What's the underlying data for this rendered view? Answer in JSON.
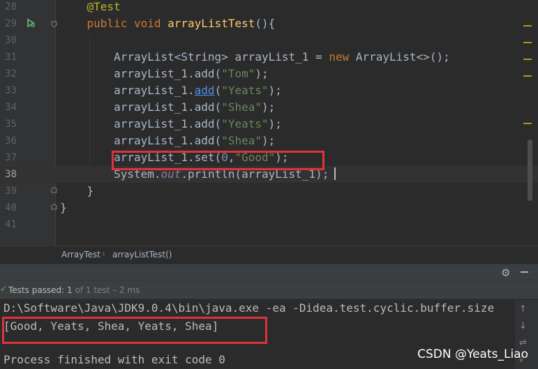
{
  "editor": {
    "lines": [
      {
        "num": "28",
        "tokens": [
          {
            "t": "    "
          },
          {
            "t": "@Test",
            "c": "t-ann"
          }
        ]
      },
      {
        "num": "29",
        "tokens": [
          {
            "t": "    "
          },
          {
            "t": "public",
            "c": "t-kw"
          },
          {
            "t": " "
          },
          {
            "t": "void",
            "c": "t-kw"
          },
          {
            "t": " "
          },
          {
            "t": "arrayListTest",
            "c": "t-fn"
          },
          {
            "t": "(){"
          }
        ]
      },
      {
        "num": "30",
        "tokens": []
      },
      {
        "num": "31",
        "tokens": [
          {
            "t": "        ArrayList<String> arrayList_1 = "
          },
          {
            "t": "new",
            "c": "t-kw"
          },
          {
            "t": " ArrayList<>();"
          }
        ]
      },
      {
        "num": "32",
        "tokens": [
          {
            "t": "        arrayList_1.add("
          },
          {
            "t": "\"Tom\"",
            "c": "t-str"
          },
          {
            "t": ");"
          }
        ]
      },
      {
        "num": "33",
        "tokens": [
          {
            "t": "        arrayList_1."
          },
          {
            "t": "add",
            "c": "t-link"
          },
          {
            "t": "("
          },
          {
            "t": "\"Yeats\"",
            "c": "t-str"
          },
          {
            "t": ");"
          }
        ]
      },
      {
        "num": "34",
        "tokens": [
          {
            "t": "        arrayList_1.add("
          },
          {
            "t": "\"Shea\"",
            "c": "t-str"
          },
          {
            "t": ");"
          }
        ]
      },
      {
        "num": "35",
        "tokens": [
          {
            "t": "        arrayList_1.add("
          },
          {
            "t": "\"Yeats\"",
            "c": "t-str"
          },
          {
            "t": ");"
          }
        ]
      },
      {
        "num": "36",
        "tokens": [
          {
            "t": "        arrayList_1.add("
          },
          {
            "t": "\"Shea\"",
            "c": "t-str"
          },
          {
            "t": ");"
          }
        ]
      },
      {
        "num": "37",
        "tokens": [
          {
            "t": "        arrayList_1.set("
          },
          {
            "t": "0",
            "c": "t-num"
          },
          {
            "t": ","
          },
          {
            "t": "\"Good\"",
            "c": "t-str"
          },
          {
            "t": ");"
          }
        ]
      },
      {
        "num": "38",
        "current": true,
        "tokens": [
          {
            "t": "        System."
          },
          {
            "t": "out",
            "c": "t-static"
          },
          {
            "t": ".println(arrayList_1);"
          }
        ]
      },
      {
        "num": "39",
        "tokens": [
          {
            "t": "    }"
          }
        ]
      },
      {
        "num": "40",
        "tokens": [
          {
            "t": "}"
          }
        ]
      },
      {
        "num": "41",
        "tokens": []
      }
    ]
  },
  "breadcrumb": {
    "class_name": "ArrayTest",
    "method_name": "arrayListTest()"
  },
  "run_panel": {
    "status_main": "Tests passed: ",
    "status_count": "1",
    "status_rest": " of 1 test – 2 ms",
    "console_lines": [
      "D:\\Software\\Java\\JDK9.0.4\\bin\\java.exe -ea -Didea.test.cyclic.buffer.size",
      "[Good, Yeats, Shea, Yeats, Shea]",
      "",
      "Process finished with exit code 0"
    ]
  },
  "watermark": "CSDN @Yeats_Liao",
  "colors": {
    "highlight_box": "#e0323a",
    "editor_bg": "#2b2b2b",
    "keyword": "#cc7832",
    "string": "#6a8759"
  }
}
